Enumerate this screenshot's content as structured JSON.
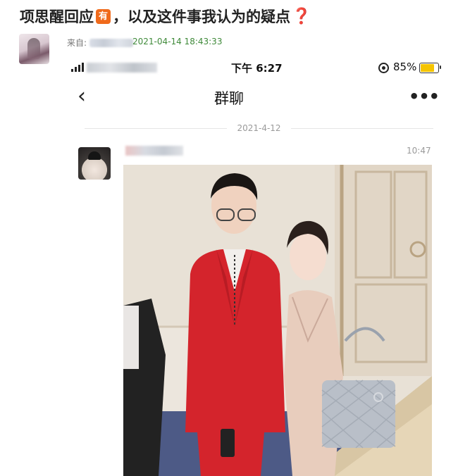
{
  "post": {
    "title_part1": "项思醒回应",
    "badge": "有",
    "title_part2": "，以及这件事我认为的疑点",
    "question_mark": "❓",
    "from_label": "来自:",
    "timestamp": "2021-04-14 18:43:33"
  },
  "status_bar": {
    "time": "下午 6:27",
    "battery": "85%",
    "battery_level": 0.85,
    "battery_color": "#f5c400"
  },
  "chat": {
    "back_icon": "chevron-left-icon",
    "title": "群聊",
    "more_icon": "more-dots-icon",
    "date_divider": "2021-4-12",
    "message_time": "10:47"
  },
  "colors": {
    "badge": "#f06a1b",
    "timestamp": "#3f8a3a",
    "question_mark": "#d8232a"
  }
}
